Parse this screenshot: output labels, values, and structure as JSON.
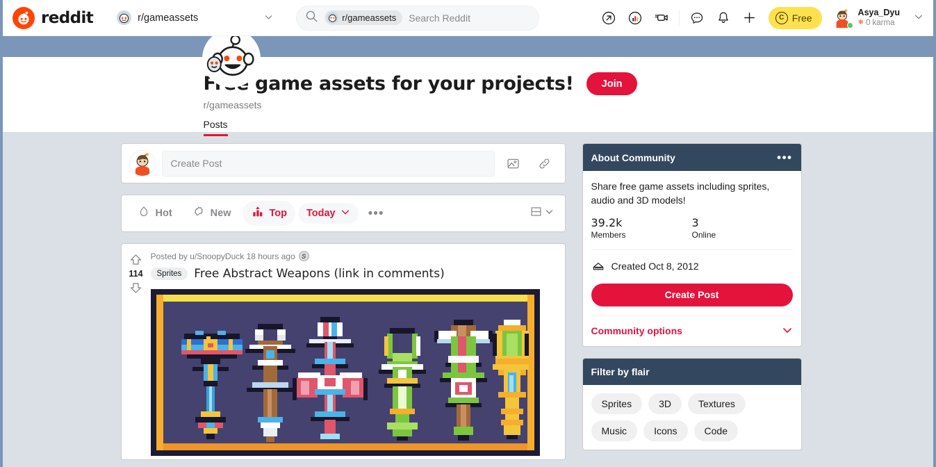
{
  "nav": {
    "brand": "reddit",
    "subreddit_label": "r/gameassets",
    "search": {
      "chip": "r/gameassets",
      "placeholder": "Search Reddit",
      "icon": "search-icon"
    },
    "icons": [
      "share-icon",
      "popular-icon",
      "video-icon",
      "chat-icon",
      "bell-icon",
      "plus-icon"
    ],
    "free_badge": "Free",
    "user": {
      "name": "Asya_Dyu",
      "karma": "0 karma"
    },
    "chevron": "⌄"
  },
  "community": {
    "title": "Free game assets for your projects!",
    "handle": "r/gameassets",
    "join_label": "Join",
    "tabs": [
      {
        "label": "Posts",
        "active": true
      }
    ],
    "banner_color": "#7b96b8"
  },
  "create_post": {
    "placeholder": "Create Post",
    "image_icon": "image-icon",
    "link_icon": "link-icon"
  },
  "sort_bar": {
    "options": [
      {
        "label": "Hot",
        "icon": "flame-icon",
        "active": false
      },
      {
        "label": "New",
        "icon": "sparkle-icon",
        "active": false
      },
      {
        "label": "Top",
        "icon": "bar-chart-icon",
        "active": true
      }
    ],
    "time_filter": "Today",
    "more": "•••",
    "view_icon": "card-view-icon"
  },
  "post": {
    "votes": "114",
    "meta": "Posted by u/SnoopyDuck 18 hours ago",
    "award_icon": "silver-award-icon",
    "flair": "Sprites",
    "title": "Free Abstract Weapons (link in comments)",
    "image": {
      "alt": "pixel art weapon sprites",
      "bg": "#454270",
      "border_outer": "#1a1a2e",
      "border_top": "#f5e04b",
      "border_bottom": "#f09527"
    }
  },
  "sidebar": {
    "about": {
      "heading": "About Community",
      "menu": "•••",
      "description": "Share free game assets including sprites, audio and 3D models!",
      "stats": [
        {
          "value": "39.2k",
          "label": "Members"
        },
        {
          "value": "3",
          "label": "Online"
        }
      ],
      "created": "Created Oct 8, 2012",
      "created_icon": "cake-icon",
      "create_post_label": "Create Post",
      "community_options": "Community options",
      "chevron": "⌄"
    },
    "flair": {
      "heading": "Filter by flair",
      "chips": [
        "Sprites",
        "3D",
        "Textures",
        "Music",
        "Icons",
        "Code"
      ]
    }
  },
  "colors": {
    "brand_red": "#e4133c",
    "orange": "#ff4500",
    "sidebar_header": "#33485e",
    "page_bg": "#dae0e6",
    "badge_yellow": "#ffe14d"
  }
}
